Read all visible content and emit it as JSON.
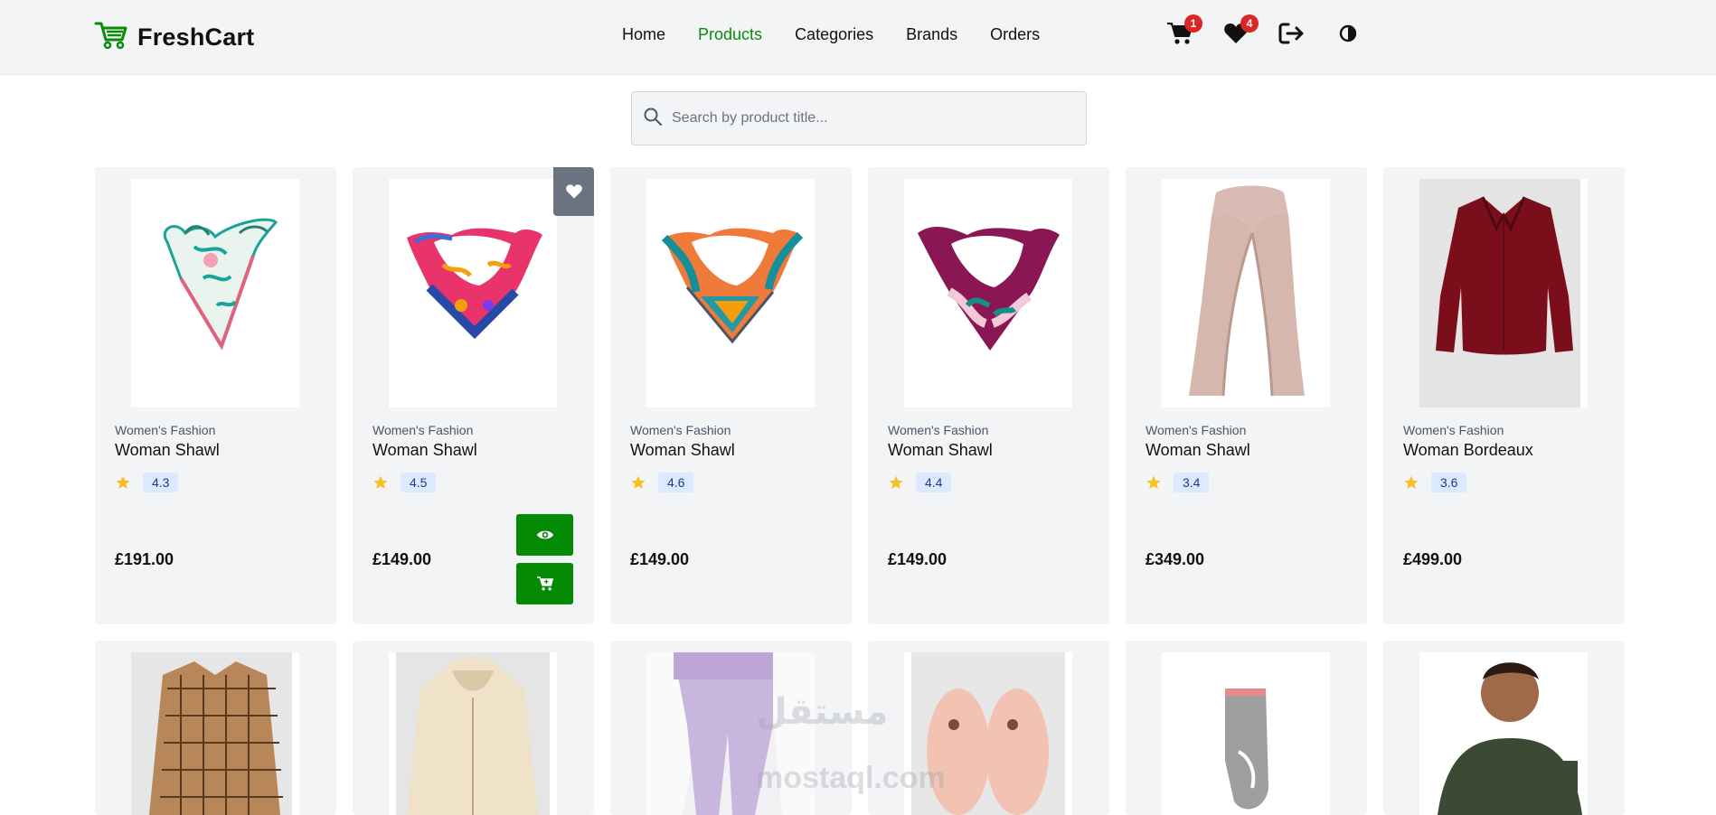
{
  "brand": {
    "name": "FreshCart",
    "icon": "cart-logo-icon"
  },
  "nav": {
    "items": [
      "Home",
      "Products",
      "Categories",
      "Brands",
      "Orders"
    ],
    "active_index": 1
  },
  "header_icons": {
    "cart": {
      "icon": "shopping-cart-icon",
      "badge": "1"
    },
    "wishlist": {
      "icon": "heart-icon",
      "badge": "4"
    },
    "logout": {
      "icon": "sign-out-icon"
    },
    "theme": {
      "icon": "contrast-icon"
    }
  },
  "search": {
    "placeholder": "Search by product title..."
  },
  "colors": {
    "accent": "#058a05",
    "badge": "#dc2626",
    "rating_bg": "#dbeafe",
    "card_bg": "#f3f4f6"
  },
  "products": [
    {
      "category": "Women's Fashion",
      "title": "Woman Shawl",
      "rating": "4.3",
      "price": "£191.00",
      "image": "scarf-teal-floral"
    },
    {
      "category": "Women's Fashion",
      "title": "Woman Shawl",
      "rating": "4.5",
      "price": "£149.00",
      "image": "scarf-pink-blue"
    },
    {
      "category": "Women's Fashion",
      "title": "Woman Shawl",
      "rating": "4.6",
      "price": "£149.00",
      "image": "scarf-orange-teal"
    },
    {
      "category": "Women's Fashion",
      "title": "Woman Shawl",
      "rating": "4.4",
      "price": "£149.00",
      "image": "scarf-purple"
    },
    {
      "category": "Women's Fashion",
      "title": "Woman Shawl",
      "rating": "3.4",
      "price": "£349.00",
      "image": "scarf-beige"
    },
    {
      "category": "Women's Fashion",
      "title": "Woman Bordeaux",
      "rating": "3.6",
      "price": "£499.00",
      "image": "blouse-bordeaux"
    }
  ],
  "second_row": [
    "plaid-shirt",
    "beige-hoodie",
    "lilac-joggers",
    "pink-slippers",
    "grey-socks",
    "green-tshirt"
  ],
  "watermark": {
    "arabic": "مستقل",
    "latin": "mostaql.com"
  }
}
